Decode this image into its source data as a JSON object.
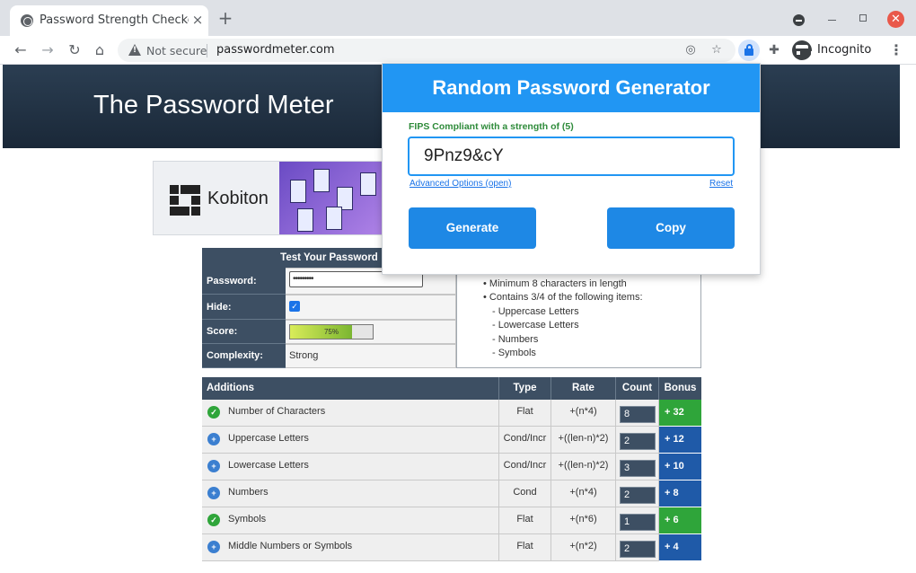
{
  "browser": {
    "tab_title": "Password Strength Checker",
    "tab_close": "×",
    "new_tab": "+",
    "security_label": "Not secure",
    "url": "passwordmeter.com",
    "profile_label": "Incognito"
  },
  "site": {
    "title": "The Password Meter",
    "ad": {
      "brand": "Kobiton"
    }
  },
  "test_panel": {
    "title": "Test Your Password",
    "rows": [
      {
        "label": "Password:",
        "value": "•••••••••"
      },
      {
        "label": "Hide:",
        "value": ""
      },
      {
        "label": "Score:",
        "value": ""
      },
      {
        "label": "Complexity:",
        "value": "Strong"
      }
    ],
    "score_text": "75%",
    "score_percent": 75,
    "requirements": [
      "•  Minimum 8 characters in length",
      "•  Contains 3/4 of the following items:",
      "   - Uppercase Letters",
      "   - Lowercase Letters",
      "   - Numbers",
      "   - Symbols"
    ]
  },
  "additions": {
    "headers": [
      "Additions",
      "Type",
      "Rate",
      "Count",
      "Bonus"
    ],
    "rows": [
      {
        "name": "Number of Characters",
        "status": "pass",
        "type": "Flat",
        "rate": "+(n*4)",
        "count": "8",
        "bonus": "+ 32"
      },
      {
        "name": "Uppercase Letters",
        "status": "exceed",
        "type": "Cond/Incr",
        "rate": "+((len-n)*2)",
        "count": "2",
        "bonus": "+ 12"
      },
      {
        "name": "Lowercase Letters",
        "status": "exceed",
        "type": "Cond/Incr",
        "rate": "+((len-n)*2)",
        "count": "3",
        "bonus": "+ 10"
      },
      {
        "name": "Numbers",
        "status": "exceed",
        "type": "Cond",
        "rate": "+(n*4)",
        "count": "2",
        "bonus": "+ 8"
      },
      {
        "name": "Symbols",
        "status": "pass",
        "type": "Flat",
        "rate": "+(n*6)",
        "count": "1",
        "bonus": "+ 6"
      },
      {
        "name": "Middle Numbers or Symbols",
        "status": "exceed",
        "type": "Flat",
        "rate": "+(n*2)",
        "count": "2",
        "bonus": "+ 4"
      }
    ]
  },
  "popup": {
    "title": "Random Password Generator",
    "strength_label": "FIPS Compliant with a strength of (5)",
    "password": "9Pnz9&cY",
    "advanced_link": "Advanced Options (open)",
    "reset_link": "Reset",
    "generate_label": "Generate",
    "copy_label": "Copy"
  },
  "colors": {
    "header_bg": "#1a2838",
    "popup_accent": "#2196f3",
    "bonus_green": "#2fa53a",
    "bonus_blue": "#1f5aa8"
  }
}
